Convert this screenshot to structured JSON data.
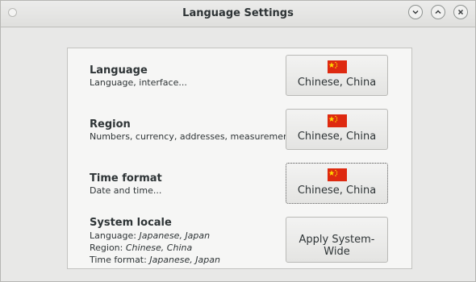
{
  "window": {
    "title": "Language Settings"
  },
  "icons": {
    "minimize": "chevron-down-icon",
    "maximize": "chevron-up-icon",
    "close": "close-icon",
    "flag": "china-flag-icon"
  },
  "colors": {
    "flag_red": "#de2910",
    "flag_star": "#ffde00"
  },
  "settings": {
    "language": {
      "label": "Language",
      "description": "Language, interface...",
      "button": "Chinese, China"
    },
    "region": {
      "label": "Region",
      "description": "Numbers, currency, addresses, measurement...",
      "button": "Chinese, China"
    },
    "time_format": {
      "label": "Time format",
      "description": "Date and time...",
      "button": "Chinese, China"
    },
    "system_locale": {
      "label": "System locale",
      "language_prefix": "Language: ",
      "language_value": "Japanese, Japan",
      "region_prefix": "Region: ",
      "region_value": "Chinese, China",
      "time_prefix": "Time format: ",
      "time_value": "Japanese, Japan",
      "button": "Apply System-Wide"
    }
  }
}
